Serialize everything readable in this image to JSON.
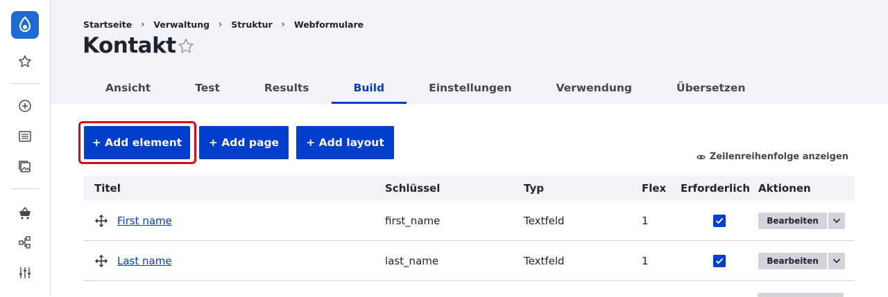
{
  "toolbar": {
    "items": [
      {
        "name": "drupal-logo"
      },
      {
        "name": "shortcuts-star"
      },
      {
        "name": "add-content"
      },
      {
        "name": "content"
      },
      {
        "name": "media"
      },
      {
        "name": "commerce"
      },
      {
        "name": "structure"
      },
      {
        "name": "configuration"
      }
    ]
  },
  "breadcrumb": [
    "Startseite",
    "Verwaltung",
    "Struktur",
    "Webformulare"
  ],
  "breadcrumb_separator": "›",
  "page": {
    "title": "Kontakt"
  },
  "tabs": [
    {
      "label": "Ansicht",
      "active": false
    },
    {
      "label": "Test",
      "active": false
    },
    {
      "label": "Results",
      "active": false
    },
    {
      "label": "Build",
      "active": true
    },
    {
      "label": "Einstellungen",
      "active": false
    },
    {
      "label": "Verwendung",
      "active": false
    },
    {
      "label": "Übersetzen",
      "active": false
    }
  ],
  "actions": {
    "add_element": "+ Add element",
    "add_page": "+ Add page",
    "add_layout": "+ Add layout",
    "row_order_toggle": "Zeilenreihenfolge anzeigen"
  },
  "table": {
    "headers": [
      "Titel",
      "Schlüssel",
      "Typ",
      "Flex",
      "Erforderlich",
      "Aktionen"
    ],
    "rows": [
      {
        "title": "First name",
        "key": "first_name",
        "type": "Textfeld",
        "flex": "1",
        "required": true,
        "action": "Bearbeiten"
      },
      {
        "title": "Last name",
        "key": "last_name",
        "type": "Textfeld",
        "flex": "1",
        "required": true,
        "action": "Bearbeiten"
      }
    ]
  },
  "colors": {
    "primary": "#003ecc",
    "logo": "#1f6bd6",
    "highlight": "#e3001b",
    "header_bg": "#f3f4f9"
  }
}
